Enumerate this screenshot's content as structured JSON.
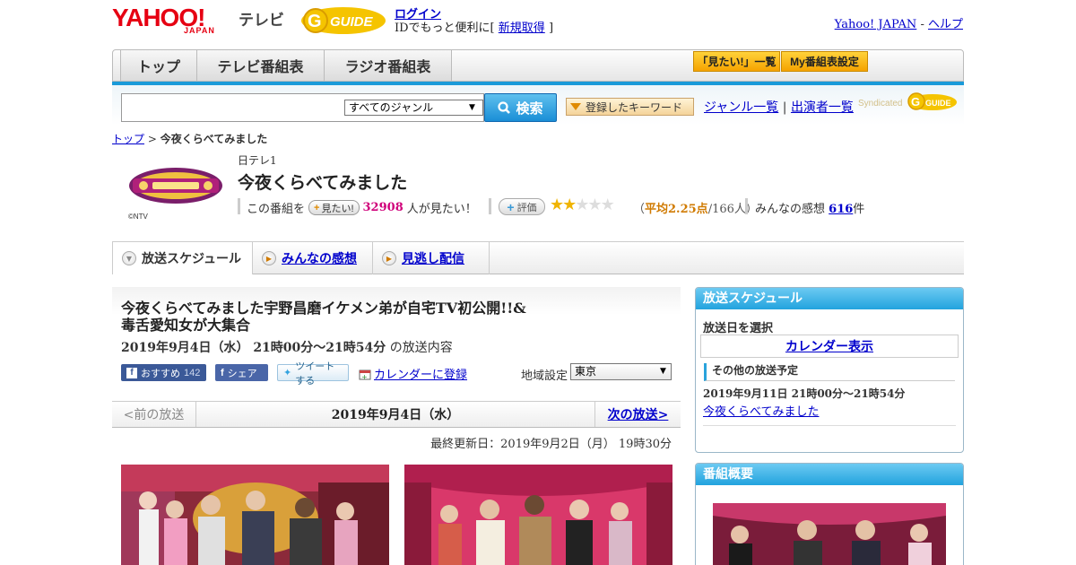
{
  "header": {
    "logo_yahoo": "YAHOO!",
    "logo_japan": "JAPAN",
    "logo_tv": "テレビ",
    "login": "ログイン",
    "login_prefix": "IDでもっと便利に[",
    "signup": "新規取得",
    "login_suffix": "]",
    "yahoo_japan": "Yahoo! JAPAN",
    "separator": "-",
    "help": "ヘルプ"
  },
  "nav": {
    "tabs": [
      "トップ",
      "テレビ番組表",
      "ラジオ番組表"
    ],
    "want_list": "「見たい!」一覧",
    "my_schedule": "My番組表設定"
  },
  "search": {
    "genre_selected": "すべてのジャンル",
    "button": "検索",
    "keyword_button": "登録したキーワード",
    "genre_list": "ジャンル一覧",
    "pipe": "|",
    "cast_list": "出演者一覧",
    "syndicated": "Syndicated"
  },
  "breadcrumb": {
    "top": "トップ",
    "sep": ">",
    "current": "今夜くらべてみました"
  },
  "program": {
    "channel": "日テレ1",
    "title": "今夜くらべてみました",
    "copyright": "©NTV",
    "want_prefix": "この番組を",
    "want_button": "見たい!",
    "want_count": "32908",
    "want_suffix": "人が見たい！",
    "rate_button": "評価",
    "rating_stars": 2.25,
    "avg_open": "（",
    "avg_label": "平均2.25点",
    "avg_rest": "/166人）",
    "kansou_label": "みんなの感想",
    "kansou_count": "616",
    "kansou_unit": "件"
  },
  "tabs": [
    "放送スケジュール",
    "みんなの感想",
    "見逃し配信"
  ],
  "episode": {
    "title": "今夜くらべてみました宇野昌磨イケメン弟が自宅TV初公開!!&毒舌愛知女が大集合",
    "date": "2019年9月4日（水） 21時00分～21時54分",
    "date_suffix": "の放送内容",
    "fb_recommend": "おすすめ",
    "fb_count": "142",
    "share": "シェア",
    "tweet": "ツイートする",
    "calendar_register": "カレンダーに登録",
    "region_label": "地域設定",
    "region_selected": "東京"
  },
  "pager": {
    "prev": "<前の放送",
    "current": "2019年9月4日（水）",
    "next": "次の放送>"
  },
  "updated": "最終更新日：2019年9月2日（月） 19時30分",
  "sidebar": {
    "schedule_head": "放送スケジュール",
    "select_date": "放送日を選択",
    "calendar": "カレンダー表示",
    "other_head": "その他の放送予定",
    "other_date": "2019年9月11日 21時00分～21時54分",
    "other_title": "今夜くらべてみました",
    "summary_head": "番組概要"
  },
  "colors": {
    "brand_red": "#e60012",
    "accent_blue": "#1a9ad9",
    "want_pink": "#d0007a",
    "star": "#f0b400"
  }
}
